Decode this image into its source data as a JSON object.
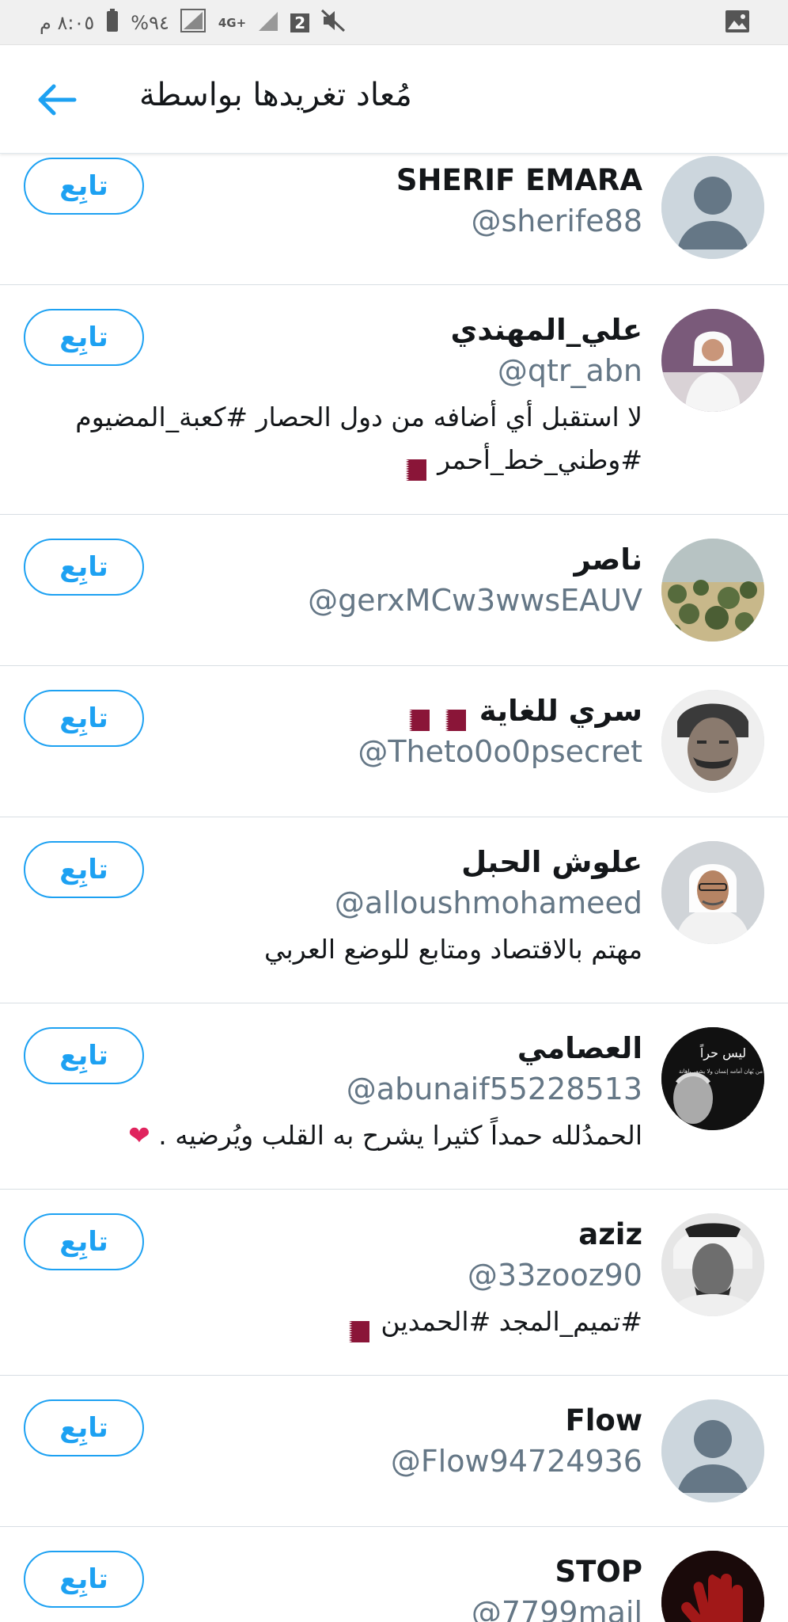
{
  "status_bar": {
    "time": "٨:٠٥ م",
    "battery": "%٩٤",
    "network": "4G+",
    "sim": "2"
  },
  "header": {
    "title": "مُعاد تغريدها بواسطة"
  },
  "follow_label": "تابِع",
  "users": [
    {
      "name": "SHERIF EMARA",
      "handle": "@sherife88",
      "bio": "",
      "avatar": "default-avatar"
    },
    {
      "name": "علي_المهندي",
      "handle": "@qtr_abn",
      "bio": "لا استقبل أي أضافه من دول الحصار #كعبة_المضيوم #وطني_خط_أحمر",
      "avatar": "photo-white-thobe"
    },
    {
      "name": "ناصر",
      "handle": "@gerxMCw3wwsEAUV",
      "bio": "",
      "avatar": "photo-mangroves"
    },
    {
      "name": "سري للغاية",
      "handle": "@Theto0o0psecret",
      "bio": "",
      "avatar": "photo-man-portrait"
    },
    {
      "name": "علوش الحبل",
      "handle": "@alloushmohameed",
      "bio": "مهتم بالاقتصاد ومتابع للوضع العربي",
      "avatar": "photo-man-car"
    },
    {
      "name": "العصامي",
      "handle": "@abunaif55228513",
      "bio": "الحمدُلله حمداً كثيرا يشرح به القلب ويُرضيه .",
      "avatar": "photo-quote-black"
    },
    {
      "name": "aziz",
      "handle": "@33zooz90",
      "bio": "#تميم_المجد #الحمدين",
      "avatar": "photo-man-ghutra"
    },
    {
      "name": "Flow",
      "handle": "@Flow94724936",
      "bio": "",
      "avatar": "default-avatar"
    },
    {
      "name": "STOP",
      "handle": "@7799mail",
      "bio": "",
      "avatar": "photo-red-hand"
    }
  ],
  "avatar_text": {
    "quote_title": "ليس حراً",
    "quote_line": "من يُهان أمامه إنسان ولا يشعر بإهانة"
  },
  "colors": {
    "accent": "#1da1f2",
    "handle": "#657786",
    "qatar_maroon": "#8a1538"
  }
}
